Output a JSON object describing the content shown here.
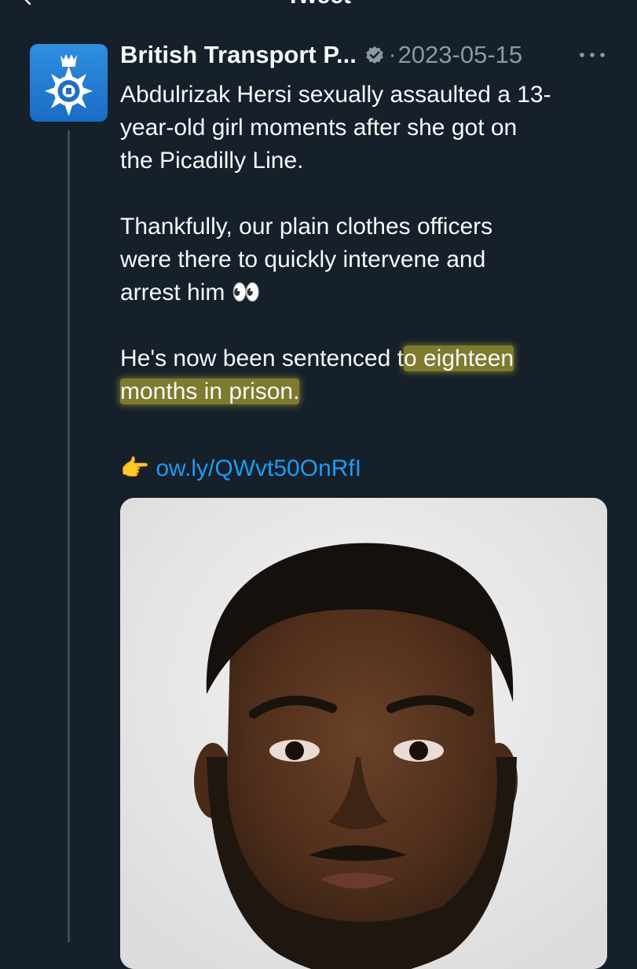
{
  "page": {
    "title": "Tweet"
  },
  "tweet": {
    "author_name": "British Transport P...",
    "date": "2023-05-15",
    "separator": "·",
    "body": {
      "line1": "Abdulrizak Hersi sexually assaulted a 13-",
      "line2": "year-old girl moments after she got on",
      "line3": "the Picadilly Line.",
      "line4": "Thankfully, our plain clothes officers",
      "line5": "were there to quickly intervene and",
      "line6": "arrest him",
      "line6_emoji": "👀",
      "line7_plain": "He's now been sentenced t",
      "line7_highlight": "o eighteen",
      "line8_highlight": "months in prison."
    },
    "link_emoji": "👉",
    "link_text": "ow.ly/QWvt50OnRfI"
  },
  "icons": {
    "back": "back-arrow-icon",
    "verified": "verified-badge-icon",
    "more": "more-options-icon",
    "link": "pointing-hand-emoji"
  },
  "colors": {
    "background": "#15202b",
    "text": "#f7f9f9",
    "secondary_text": "#8b98a5",
    "link": "#1d9bf0",
    "highlight": "#beb230",
    "thread_line": "#3d4b57"
  }
}
